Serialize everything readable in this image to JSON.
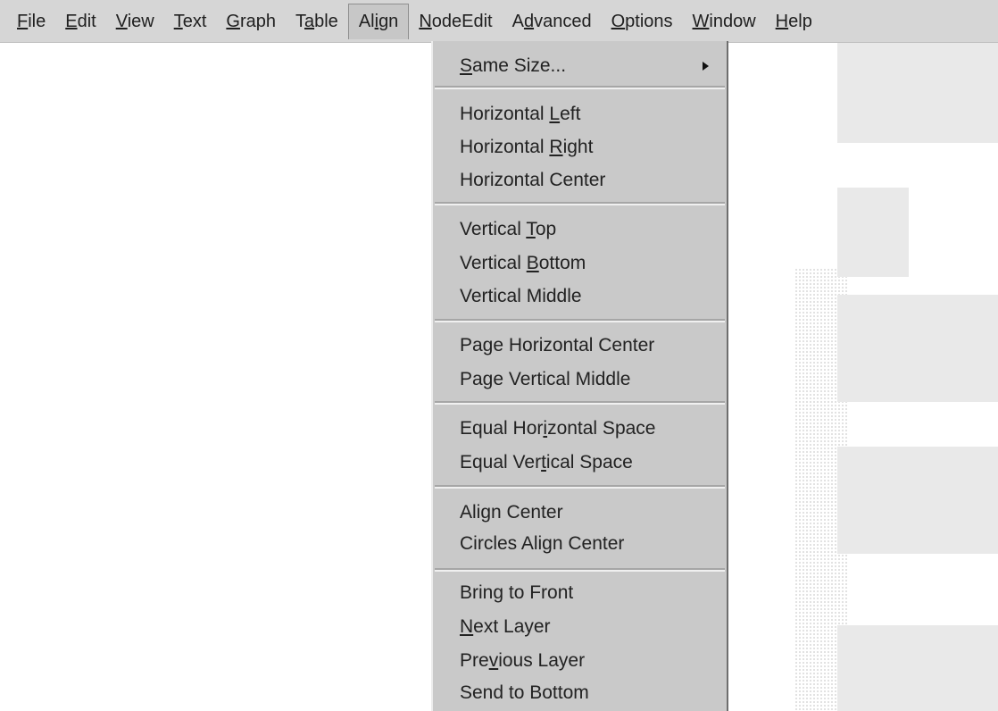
{
  "menubar": {
    "items": [
      {
        "label_pre": "",
        "mnemonic": "F",
        "label_post": "ile"
      },
      {
        "label_pre": "",
        "mnemonic": "E",
        "label_post": "dit"
      },
      {
        "label_pre": "",
        "mnemonic": "V",
        "label_post": "iew"
      },
      {
        "label_pre": "",
        "mnemonic": "T",
        "label_post": "ext"
      },
      {
        "label_pre": "",
        "mnemonic": "G",
        "label_post": "raph"
      },
      {
        "label_pre": "T",
        "mnemonic": "a",
        "label_post": "ble"
      },
      {
        "label_pre": "Al",
        "mnemonic": "i",
        "label_post": "gn"
      },
      {
        "label_pre": "",
        "mnemonic": "N",
        "label_post": "odeEdit"
      },
      {
        "label_pre": "A",
        "mnemonic": "d",
        "label_post": "vanced"
      },
      {
        "label_pre": "",
        "mnemonic": "O",
        "label_post": "ptions"
      },
      {
        "label_pre": "",
        "mnemonic": "W",
        "label_post": "indow"
      },
      {
        "label_pre": "",
        "mnemonic": "H",
        "label_post": "elp"
      }
    ],
    "active_index": 6
  },
  "align_menu": {
    "same_size": {
      "pre": "",
      "mn": "S",
      "post": "ame Size..."
    },
    "horizontal_left": {
      "pre": "Horizontal ",
      "mn": "L",
      "post": "eft"
    },
    "horizontal_right": {
      "pre": "Horizontal ",
      "mn": "R",
      "post": "ight"
    },
    "horizontal_center": {
      "pre": "Horizontal Center",
      "mn": "",
      "post": ""
    },
    "vertical_top": {
      "pre": "Vertical ",
      "mn": "T",
      "post": "op"
    },
    "vertical_bottom": {
      "pre": "Vertical ",
      "mn": "B",
      "post": "ottom"
    },
    "vertical_middle": {
      "pre": "Vertical Middle",
      "mn": "",
      "post": ""
    },
    "page_horizontal_center": {
      "pre": "Page Horizontal Center",
      "mn": "",
      "post": ""
    },
    "page_vertical_middle": {
      "pre": "Page Vertical Middle",
      "mn": "",
      "post": ""
    },
    "equal_horizontal_space": {
      "pre": "Equal Hor",
      "mn": "i",
      "post": "zontal Space"
    },
    "equal_vertical_space": {
      "pre": "Equal Ver",
      "mn": "t",
      "post": "ical Space"
    },
    "align_center": {
      "pre": "Align Center",
      "mn": "",
      "post": ""
    },
    "circles_align_center": {
      "pre": "Circles Align Center",
      "mn": "",
      "post": ""
    },
    "bring_to_front": {
      "pre": "Bring to Front",
      "mn": "",
      "post": ""
    },
    "next_layer": {
      "pre": "",
      "mn": "N",
      "post": "ext Layer"
    },
    "previous_layer": {
      "pre": "Pre",
      "mn": "v",
      "post": "ious Layer"
    },
    "send_to_bottom": {
      "pre": "Send to Bottom",
      "mn": "",
      "post": ""
    }
  },
  "icons": {
    "submenu_arrow": "triangle-right-icon"
  }
}
